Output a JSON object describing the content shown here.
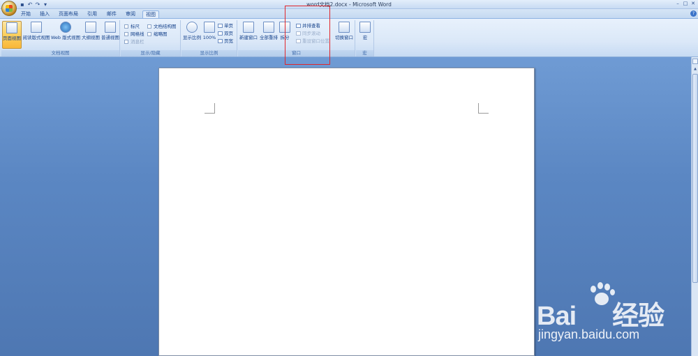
{
  "window": {
    "title": "word文档2.docx - Microsoft Word",
    "controls": [
      "–",
      "□",
      "✕"
    ]
  },
  "qat": {
    "icons": [
      "save-icon",
      "undo-icon",
      "redo-icon",
      "customize-icon"
    ]
  },
  "tabs": [
    {
      "label": "开始"
    },
    {
      "label": "插入"
    },
    {
      "label": "页面布局"
    },
    {
      "label": "引用"
    },
    {
      "label": "邮件"
    },
    {
      "label": "审阅"
    },
    {
      "label": "视图",
      "active": true
    }
  ],
  "ribbon": {
    "doc_views": {
      "label": "文档视图",
      "buttons": [
        "页面视图",
        "阅读版式视图",
        "Web 版式视图",
        "大纲视图",
        "普通视图"
      ]
    },
    "show_hide": {
      "label": "显示/隐藏",
      "checks": [
        "标尺",
        "网格线",
        "消息栏",
        "文档结构图",
        "缩略图"
      ]
    },
    "zoom": {
      "label": "显示比例",
      "zoom_button": "显示比例",
      "percent_button": "100%",
      "small": [
        "单页",
        "双页",
        "页宽"
      ]
    },
    "window": {
      "label": "窗口",
      "big": [
        "新建窗口",
        "全部重排",
        "拆分"
      ],
      "small": [
        "并排查看",
        "同步滚动",
        "重设窗口位置"
      ],
      "switch": "切换窗口"
    },
    "macros": {
      "label": "宏",
      "button": "宏"
    }
  },
  "watermark": {
    "brand": "Bai",
    "brand2": "经验",
    "url": "jingyan.baidu.com"
  },
  "colors": {
    "highlight": "#e0262b",
    "ribbon_text": "#15428b"
  }
}
